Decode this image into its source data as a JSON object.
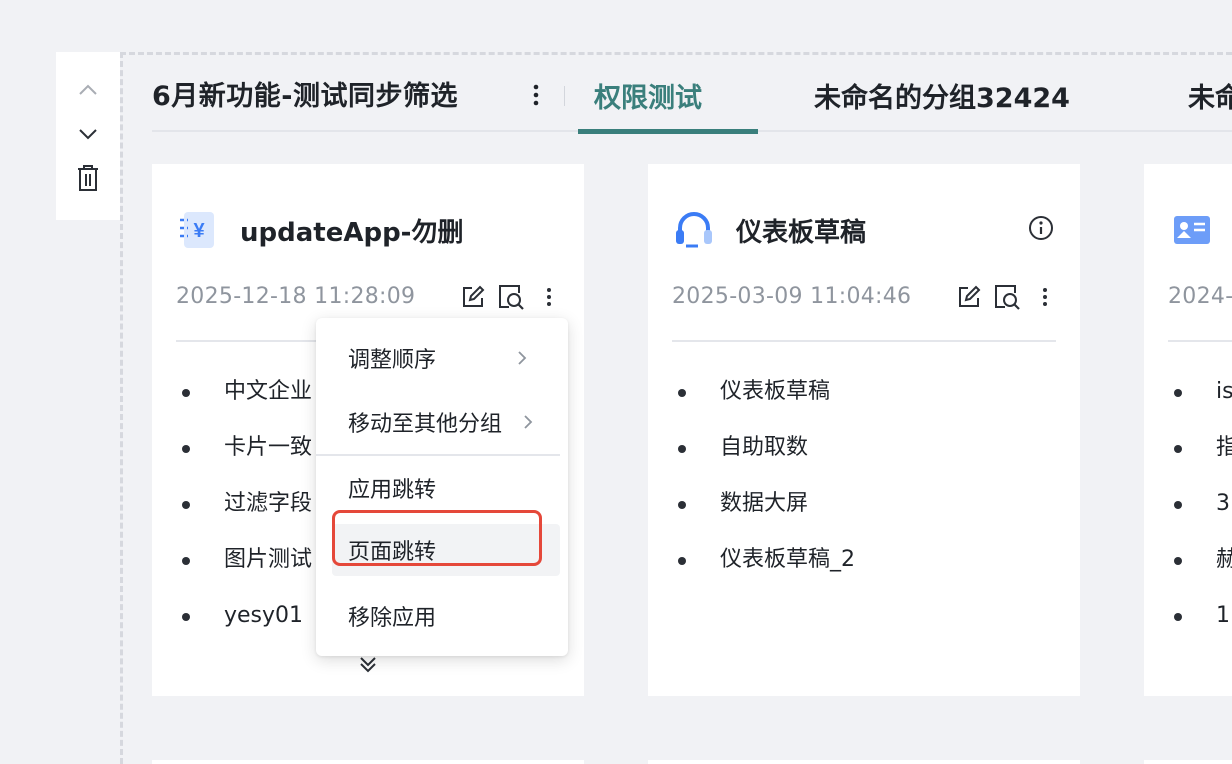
{
  "tabs": {
    "current_group": "6月新功能-测试同步筛选",
    "items": [
      {
        "label": "权限测试",
        "active": true
      },
      {
        "label": "未命名的分组32424",
        "active": false
      },
      {
        "label": "未命",
        "active": false
      }
    ]
  },
  "cards": [
    {
      "title": "updateApp-勿删",
      "date": "2025-12-18 11:28:09",
      "icon": "yuan-document-icon",
      "items": [
        "中文企业",
        "卡片一致",
        "过滤字段",
        "图片测试",
        "yesy01"
      ]
    },
    {
      "title": "仪表板草稿",
      "date": "2025-03-09 11:04:46",
      "icon": "headset-icon",
      "items": [
        "仪表板草稿",
        "自助取数",
        "数据大屏",
        "仪表板草稿_2"
      ]
    },
    {
      "title": "",
      "date": "2024-",
      "icon": "id-card-icon",
      "items": [
        "is",
        "指",
        "3.",
        "赫",
        "1."
      ]
    }
  ],
  "menu": {
    "items": [
      {
        "label": "调整顺序",
        "has_submenu": true
      },
      {
        "label": "移动至其他分组",
        "has_submenu": true
      },
      {
        "label": "应用跳转",
        "has_submenu": false
      },
      {
        "label": "页面跳转",
        "has_submenu": false,
        "highlighted": true
      },
      {
        "label": "移除应用",
        "has_submenu": false
      }
    ]
  },
  "colors": {
    "accent": "#3a7f7c",
    "highlight": "#e5483a",
    "icon_blue": "#3b7cf5"
  }
}
